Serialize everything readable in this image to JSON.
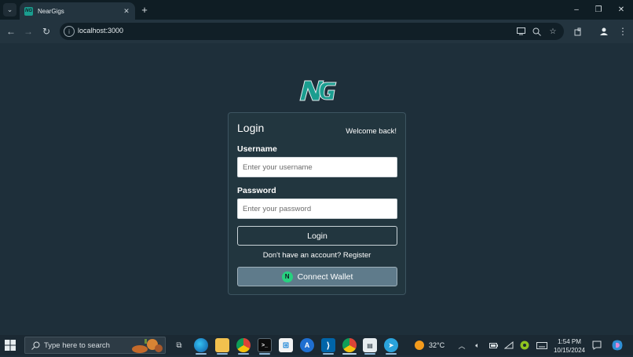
{
  "browser": {
    "tab_title": "NearGigs",
    "tab_close_glyph": "✕",
    "new_tab_glyph": "+",
    "tab_list_glyph": "⌄",
    "url": "localhost:3000",
    "window_controls": {
      "minimize": "–",
      "restore": "❐",
      "close": "✕"
    },
    "nav": {
      "back": "←",
      "forward": "→",
      "reload": "↻"
    },
    "omnibox_icons": [
      "install-icon",
      "zoom-icon",
      "bookmark-star-icon"
    ],
    "toolbar_icons": [
      "extensions-icon",
      "profile-icon",
      "menu-icon"
    ]
  },
  "page": {
    "logo_text": "NG",
    "card": {
      "title": "Login",
      "welcome": "Welcome back!",
      "username": {
        "label": "Username",
        "placeholder": "Enter your username",
        "value": ""
      },
      "password": {
        "label": "Password",
        "placeholder": "Enter your password",
        "value": ""
      },
      "login_button": "Login",
      "register_prompt": "Don't have an account?",
      "register_link": "Register",
      "connect_wallet_button": "Connect Wallet",
      "wallet_icon_letter": "N"
    },
    "colors": {
      "background": "#1e2f3a",
      "card": "#22363f",
      "wallet_button": "#5f7b8b",
      "wallet_icon": "#27d17f",
      "logo": "#1a9d8f"
    }
  },
  "taskbar": {
    "search_placeholder": "Type here to search",
    "apps": [
      "task-view-icon",
      "edge-icon",
      "file-explorer-icon",
      "chrome-icon",
      "terminal-icon",
      "store-icon",
      "app-icon",
      "vscode-icon",
      "chrome-active-icon",
      "teams-icon",
      "telegram-icon"
    ],
    "weather": "32°C",
    "time": "1:54 PM",
    "date": "10/15/2024"
  }
}
